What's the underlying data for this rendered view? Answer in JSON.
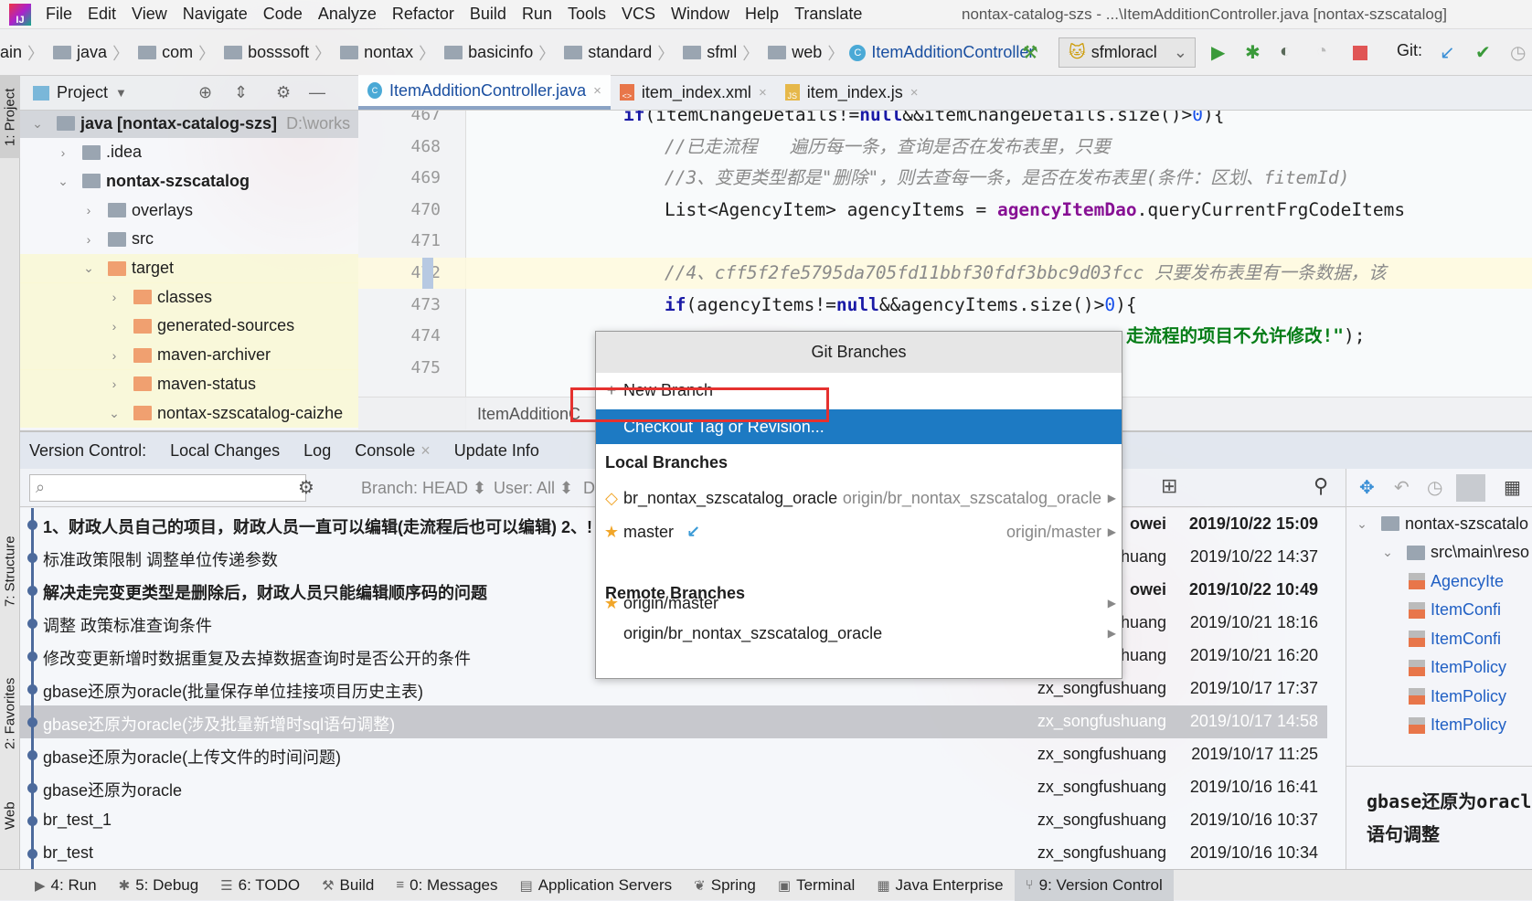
{
  "menubar": {
    "items": [
      "File",
      "Edit",
      "View",
      "Navigate",
      "Code",
      "Analyze",
      "Refactor",
      "Build",
      "Run",
      "Tools",
      "VCS",
      "Window",
      "Help",
      "Translate"
    ],
    "title": "nontax-catalog-szs - ...\\ItemAdditionController.java [nontax-szscatalog]"
  },
  "navbar": {
    "crumbs": [
      "ain",
      "java",
      "com",
      "bosssoft",
      "nontax",
      "basicinfo",
      "standard",
      "sfml",
      "web"
    ],
    "current": "ItemAdditionController",
    "run_config": "sfmloracl",
    "git_label": "Git:"
  },
  "left_strip": {
    "project": "1: Project",
    "structure": "7: Structure",
    "favorites": "2: Favorites",
    "web": "Web"
  },
  "project": {
    "title": "Project",
    "tree": [
      {
        "label": "java [nontax-catalog-szs]",
        "suffix": "D:\\works",
        "depth": 0,
        "expanded": true,
        "bold": true,
        "kind": "module"
      },
      {
        "label": ".idea",
        "depth": 1,
        "expanded": false,
        "kind": "folder"
      },
      {
        "label": "nontax-szscatalog",
        "depth": 1,
        "expanded": true,
        "bold": true,
        "kind": "module"
      },
      {
        "label": "overlays",
        "depth": 2,
        "expanded": false,
        "kind": "folder"
      },
      {
        "label": "src",
        "depth": 2,
        "expanded": false,
        "kind": "folder"
      },
      {
        "label": "target",
        "depth": 2,
        "expanded": true,
        "kind": "excluded"
      },
      {
        "label": "classes",
        "depth": 3,
        "expanded": false,
        "kind": "excluded"
      },
      {
        "label": "generated-sources",
        "depth": 3,
        "expanded": false,
        "kind": "excluded"
      },
      {
        "label": "maven-archiver",
        "depth": 3,
        "expanded": false,
        "kind": "excluded"
      },
      {
        "label": "maven-status",
        "depth": 3,
        "expanded": false,
        "kind": "excluded"
      },
      {
        "label": "nontax-szscatalog-caizhe",
        "depth": 3,
        "expanded": true,
        "kind": "excluded"
      }
    ]
  },
  "editor": {
    "tabs": [
      {
        "label": "ItemAdditionController.java",
        "type": "java",
        "active": true
      },
      {
        "label": "item_index.xml",
        "type": "xml"
      },
      {
        "label": "item_index.js",
        "type": "js"
      }
    ],
    "lines": [
      {
        "n": "467",
        "html": "<span class=\"kw\">if</span>(itemChangeDetails!=<span class=\"kw\">null</span>&amp;&amp;itemChangeDetails.size()&gt;<span style=\"color:#1750eb\">0</span>){",
        "indent": 0
      },
      {
        "n": "468",
        "html": "<span class=\"cm\">//已走流程   遍历每一条，查询是否在发布表里，只要</span>",
        "indent": 1
      },
      {
        "n": "469",
        "html": "<span class=\"cm\">//3、变更类型都是\"删除\"，则去查每一条，是否在发布表里(条件：区划、fitemId)</span>",
        "indent": 1
      },
      {
        "n": "470",
        "html": "List&lt;AgencyItem&gt; agencyItems = <span class=\"fld\">agencyItemDao</span>.queryCurrentFrgCodeItems",
        "indent": 1
      },
      {
        "n": "471",
        "html": "",
        "indent": 1
      },
      {
        "n": "472",
        "html": "<span class=\"cm\">//4、cff5f2fe5795da705fd11bbf30fdf3bbc9d03fcc 只要发布表里有一条数据，该</span>",
        "indent": 1,
        "current": true
      },
      {
        "n": "473",
        "html": "<span class=\"kw\">if</span>(agencyItems!=<span class=\"kw\">null</span>&amp;&amp;agencyItems.size()&gt;<span style=\"color:#1750eb\">0</span>){",
        "indent": 1
      },
      {
        "n": "474",
        "html": "<span class=\"str\">走流程的项目不允许修改!\"</span>);",
        "indent": 2
      },
      {
        "n": "475",
        "html": "",
        "indent": 2
      }
    ],
    "breadcrumb": "ItemAdditionC"
  },
  "vcs": {
    "tabs": [
      "Version Control:",
      "Local Changes",
      "Log",
      "Console",
      "Update Info"
    ],
    "filters": {
      "branch": "Branch: HEAD",
      "user": "User: All",
      "date": "D"
    },
    "log": [
      {
        "msg": "1、财政人员自己的项目，财政人员一直可以编辑(走流程后也可以编辑) 2、!",
        "author": "owei",
        "date": "2019/10/22 15:09",
        "bold": true
      },
      {
        "msg": "标准政策限制 调整单位传递参数",
        "author": "huang",
        "date": "2019/10/22 14:37"
      },
      {
        "msg": "解决走完变更类型是删除后，财政人员只能编辑顺序码的问题",
        "author": "owei",
        "date": "2019/10/22 10:49",
        "bold": true
      },
      {
        "msg": "调整 政策标准查询条件",
        "author": "zx_songfushuang",
        "date": "2019/10/21 18:16"
      },
      {
        "msg": "修改变更新增时数据重复及去掉数据查询时是否公开的条件",
        "author": "zx_songfushuang",
        "date": "2019/10/21 16:20"
      },
      {
        "msg": "gbase还原为oracle(批量保存单位挂接项目历史主表)",
        "author": "zx_songfushuang",
        "date": "2019/10/17 17:37"
      },
      {
        "msg": "gbase还原为oracle(涉及批量新增时sql语句调整)",
        "author": "zx_songfushuang",
        "date": "2019/10/17 14:58",
        "selected": true
      },
      {
        "msg": "gbase还原为oracle(上传文件的时间问题)",
        "author": "zx_songfushuang",
        "date": "2019/10/17 11:25"
      },
      {
        "msg": "gbase还原为oracle",
        "author": "zx_songfushuang",
        "date": "2019/10/16 16:41"
      },
      {
        "msg": "br_test_1",
        "author": "zx_songfushuang",
        "date": "2019/10/16 10:37"
      },
      {
        "msg": "br_test",
        "author": "zx_songfushuang",
        "date": "2019/10/16 10:34"
      }
    ],
    "changes_tree": [
      {
        "label": "nontax-szscatalo",
        "depth": 0,
        "kind": "module"
      },
      {
        "label": "src\\main\\reso",
        "depth": 1,
        "kind": "folder"
      },
      {
        "label": "AgencyIte",
        "depth": 2,
        "kind": "xml"
      },
      {
        "label": "ItemConfi",
        "depth": 2,
        "kind": "xml"
      },
      {
        "label": "ItemConfi",
        "depth": 2,
        "kind": "xml"
      },
      {
        "label": "ItemPolicy",
        "depth": 2,
        "kind": "xml"
      },
      {
        "label": "ItemPolicy",
        "depth": 2,
        "kind": "xml"
      },
      {
        "label": "ItemPolicy",
        "depth": 2,
        "kind": "xml"
      }
    ],
    "details": "gbase还原为oracle(涉及批量新增时sql语句调整"
  },
  "statusbar": {
    "tabs": [
      {
        "label": "4: Run",
        "icon": "▶"
      },
      {
        "label": "5: Debug",
        "icon": "✱"
      },
      {
        "label": "6: TODO",
        "icon": "☰"
      },
      {
        "label": "Build",
        "icon": "⚒"
      },
      {
        "label": "0: Messages",
        "icon": "≡"
      },
      {
        "label": "Application Servers",
        "icon": "▤"
      },
      {
        "label": "Spring",
        "icon": "❦"
      },
      {
        "label": "Terminal",
        "icon": "▣"
      },
      {
        "label": "Java Enterprise",
        "icon": "▦"
      },
      {
        "label": "9: Version Control",
        "icon": "⑂",
        "active": true
      }
    ]
  },
  "git_popup": {
    "title": "Git Branches",
    "new_branch": "New Branch",
    "checkout": "Checkout Tag or Revision...",
    "local_header": "Local Branches",
    "remote_header": "Remote Branches",
    "local": [
      {
        "name": "br_nontax_szscatalog_oracle",
        "tracking": "origin/br_nontax_szscatalog_oracle",
        "icon": "tag"
      },
      {
        "name": "master",
        "tracking": "origin/master",
        "icon": "star",
        "incoming": true
      }
    ],
    "remote": [
      {
        "name": "origin/master",
        "icon": "star"
      },
      {
        "name": "origin/br_nontax_szscatalog_oracle",
        "icon": ""
      }
    ]
  },
  "colors": {
    "selection": "#1d7ac3",
    "highlight_box": "#e5312f",
    "graph": "#4c6a9c",
    "accent_star": "#f1a62a"
  }
}
